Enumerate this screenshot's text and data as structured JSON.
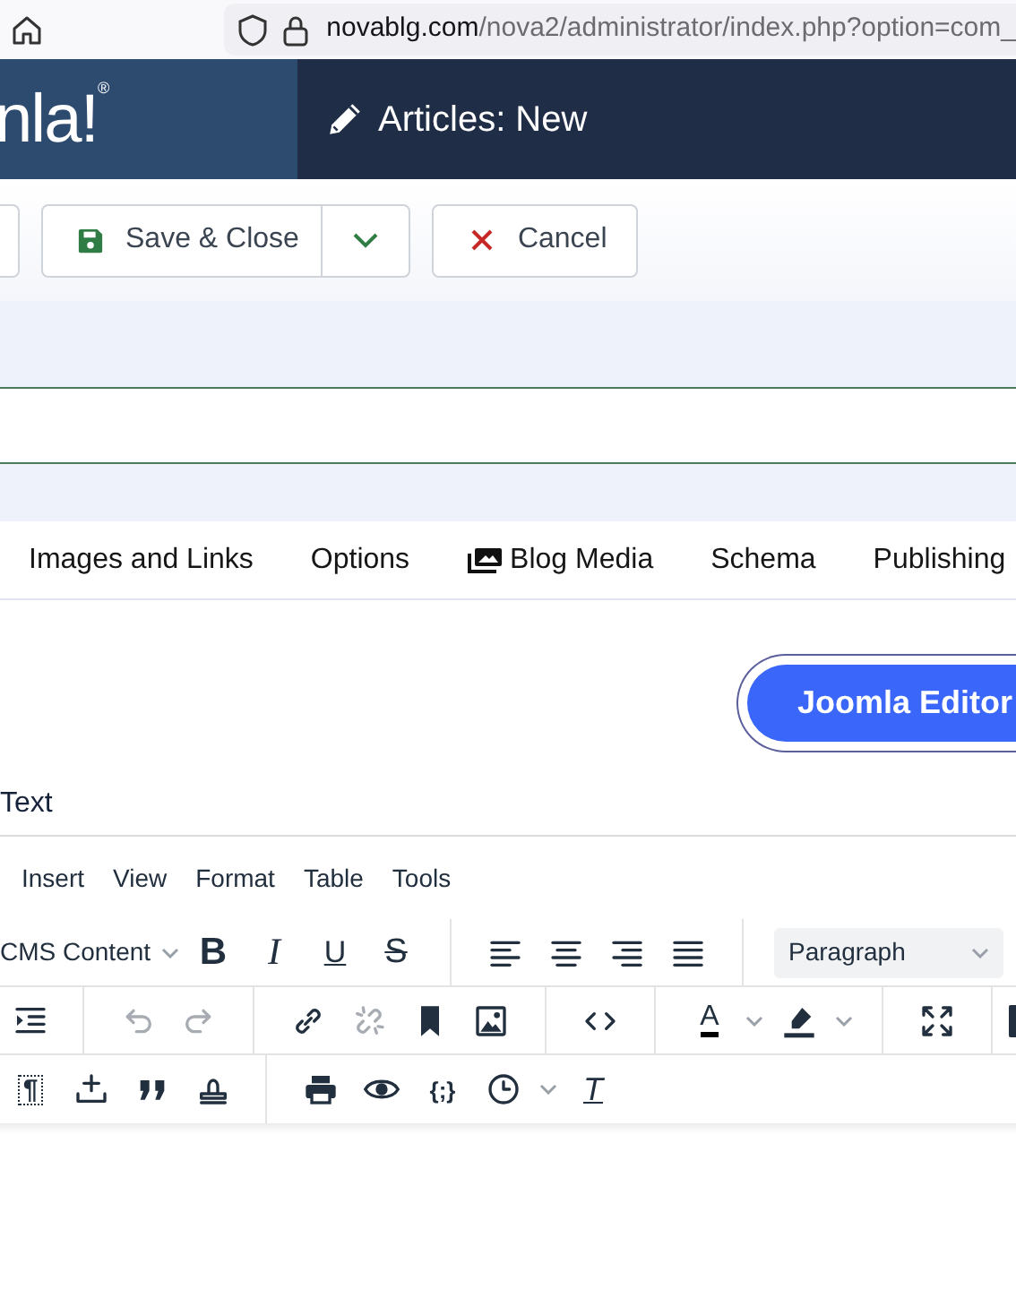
{
  "browser": {
    "url_host": "novablg.com",
    "url_path": "/nova2/administrator/index.php?option=com_"
  },
  "header": {
    "logo": "nla!$^{®}$",
    "title": "Articles: New"
  },
  "toolbar": {
    "buttons": [
      {
        "label": "Save & Close",
        "kind": "save"
      },
      {
        "label": "Cancel",
        "kind": "cancel"
      }
    ]
  },
  "tabs": [
    {
      "label": "Images and Links",
      "selected": false
    },
    {
      "label": "Options",
      "selected": false
    },
    {
      "label": "Blog Media",
      "selected": false
    },
    {
      "label": "Schema",
      "selected": false
    },
    {
      "label": "Publishing",
      "selected": false
    }
  ],
  "editor": {
    "toggle_label": "Joomla Editor",
    "field_label": "Text",
    "menu": [
      "Insert",
      "View",
      "Format",
      "Table",
      "Tools"
    ],
    "font_menu": "CMS Content",
    "block_format": "Paragraph",
    "rows": [
      [
        {
          "kind": "glyph",
          "label": "B",
          "disabled": false
        },
        {
          "kind": "glyph",
          "label": "I",
          "disabled": false
        },
        {
          "kind": "glyph",
          "label": "U",
          "disabled": false
        },
        {
          "kind": "glyph",
          "label": "S",
          "disabled": false
        },
        {
          "kind": "icon",
          "disabled": false
        },
        {
          "kind": "icon",
          "disabled": false
        },
        {
          "kind": "icon",
          "disabled": false
        },
        {
          "kind": "icon",
          "disabled": false
        }
      ],
      [
        {
          "kind": "icon",
          "disabled": false
        },
        {
          "kind": "icon",
          "disabled": true
        },
        {
          "kind": "icon",
          "disabled": true
        },
        {
          "kind": "icon",
          "disabled": false
        },
        {
          "kind": "icon",
          "disabled": true
        },
        {
          "kind": "icon",
          "disabled": false
        },
        {
          "kind": "icon",
          "disabled": false
        },
        {
          "kind": "icon",
          "disabled": false
        },
        {
          "kind": "glyph",
          "label": "A",
          "disabled": false
        },
        {
          "kind": "icon",
          "disabled": false
        },
        {
          "kind": "icon",
          "disabled": false
        }
      ],
      [
        {
          "kind": "glyph",
          "label": "¶",
          "disabled": false
        },
        {
          "kind": "icon",
          "disabled": false
        },
        {
          "kind": "icon",
          "disabled": false
        },
        {
          "kind": "icon",
          "disabled": false
        },
        {
          "kind": "icon",
          "disabled": false
        },
        {
          "kind": "icon",
          "disabled": false
        },
        {
          "kind": "glyph",
          "label": "{;}",
          "disabled": false
        },
        {
          "kind": "icon",
          "disabled": false
        },
        {
          "kind": "glyph",
          "label": "T",
          "disabled": false
        }
      ]
    ]
  }
}
